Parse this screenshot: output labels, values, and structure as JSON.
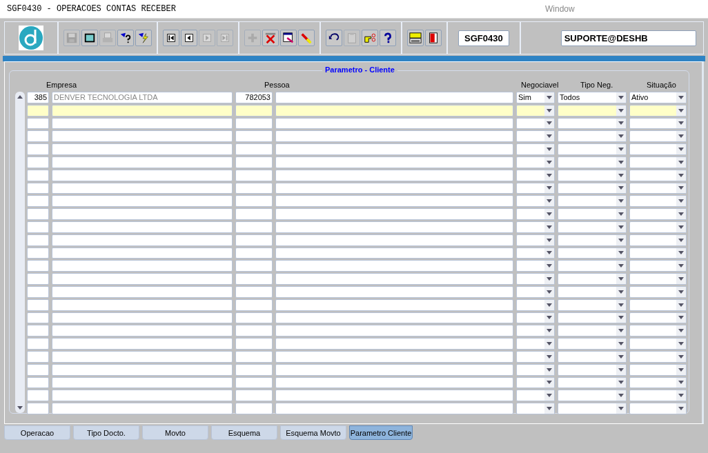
{
  "window": {
    "title": "SGF0430 - OPERACOES CONTAS RECEBER",
    "menu": "Window"
  },
  "toolbar": {
    "groups": [
      [
        {
          "kind": "save",
          "disabled": true
        },
        {
          "kind": "screen",
          "disabled": false
        },
        {
          "kind": "print",
          "disabled": true
        },
        {
          "kind": "query",
          "disabled": false
        },
        {
          "kind": "execute",
          "disabled": false
        }
      ],
      [
        {
          "kind": "first",
          "disabled": false
        },
        {
          "kind": "prev",
          "disabled": false
        },
        {
          "kind": "next",
          "disabled": true
        },
        {
          "kind": "last",
          "disabled": true
        }
      ],
      [
        {
          "kind": "add",
          "disabled": true
        },
        {
          "kind": "delete",
          "disabled": false
        },
        {
          "kind": "edit",
          "disabled": false
        },
        {
          "kind": "clear",
          "disabled": false
        }
      ],
      [
        {
          "kind": "undo",
          "disabled": false
        },
        {
          "kind": "clipboard",
          "disabled": true
        },
        {
          "kind": "point",
          "disabled": false
        },
        {
          "kind": "help",
          "disabled": false
        }
      ],
      [
        {
          "kind": "menu",
          "disabled": false
        },
        {
          "kind": "exit",
          "disabled": false
        }
      ]
    ],
    "form_code": "SGF0430",
    "user": "SUPORTE@DESHB"
  },
  "section_title": "Parametro - Cliente",
  "columns": [
    "Empresa",
    "Pessoa",
    "Negociavel",
    "Tipo Neg.",
    "Situação"
  ],
  "rows": [
    {
      "current": false,
      "empresa": "385",
      "empresa_nome": "DENVER TECNOLOGIA LTDA",
      "pessoa": "782053",
      "negociavel": "Sim",
      "tipo_neg": "Todos",
      "situacao": "Ativo"
    },
    {
      "current": true
    },
    {
      "current": false
    },
    {
      "current": false
    },
    {
      "current": false
    },
    {
      "current": false
    },
    {
      "current": false
    },
    {
      "current": false
    },
    {
      "current": false
    },
    {
      "current": false
    },
    {
      "current": false
    },
    {
      "current": false
    },
    {
      "current": false
    },
    {
      "current": false
    },
    {
      "current": false
    },
    {
      "current": false
    },
    {
      "current": false
    },
    {
      "current": false
    },
    {
      "current": false
    },
    {
      "current": false
    },
    {
      "current": false
    },
    {
      "current": false
    },
    {
      "current": false
    },
    {
      "current": false
    },
    {
      "current": false
    }
  ],
  "tabs": [
    {
      "label": "Operacao",
      "selected": false
    },
    {
      "label": "Tipo Docto.",
      "selected": false
    },
    {
      "label": "Movto",
      "selected": false
    },
    {
      "label": "Esquema",
      "selected": false
    },
    {
      "label": "Esquema Movto",
      "selected": false
    },
    {
      "label": "Parametro Cliente",
      "selected": true
    }
  ]
}
